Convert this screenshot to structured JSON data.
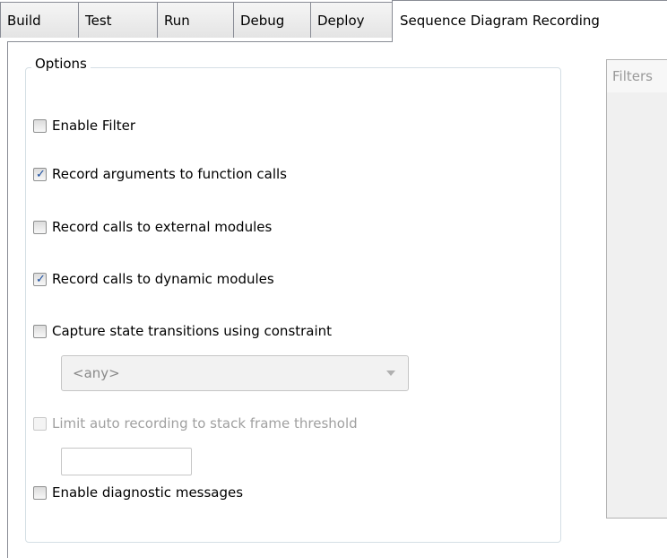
{
  "tabs": [
    "Build",
    "Test",
    "Run",
    "Debug",
    "Deploy",
    "Sequence Diagram Recording"
  ],
  "options": {
    "group_title": "Options",
    "enable_filter": {
      "label": "Enable Filter",
      "checked": false,
      "enabled": true
    },
    "record_arguments": {
      "label": "Record arguments to function calls",
      "checked": true,
      "enabled": true
    },
    "record_external": {
      "label": "Record calls to external modules",
      "checked": false,
      "enabled": true
    },
    "record_dynamic": {
      "label": "Record calls to dynamic modules",
      "checked": true,
      "enabled": true
    },
    "capture_state": {
      "label": "Capture state transitions using constraint",
      "checked": false,
      "enabled": true
    },
    "constraint_select_value": "<any>",
    "limit_auto": {
      "label": "Limit auto recording to stack frame threshold",
      "checked": false,
      "enabled": false
    },
    "threshold_value": "",
    "enable_diagnostic": {
      "label": "Enable diagnostic messages",
      "checked": false,
      "enabled": true
    }
  },
  "filters": {
    "header": "Filters"
  },
  "colors": {
    "check_mark": "#1a4ea0",
    "disabled_text": "#a0a0a0",
    "tab_border": "#898c95"
  }
}
